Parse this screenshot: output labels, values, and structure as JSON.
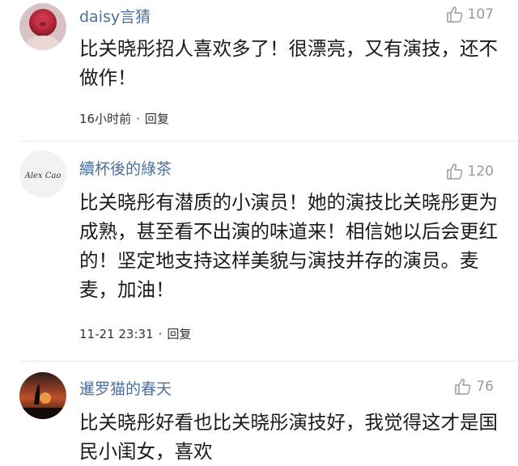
{
  "comments": [
    {
      "username": "daisy言猜",
      "likes": "107",
      "text": "比关晓彤招人喜欢多了！很漂亮，又有演技，还不做作！",
      "time": "16小时前",
      "reply": "回复",
      "avatar": "rose"
    },
    {
      "username": "續杯後的綠茶",
      "likes": "120",
      "text": "比关晓彤有潜质的小演员！她的演技比关晓彤更为成熟，甚至看不出演的味道来！相信她以后会更红的！坚定地支持这样美貌与演技并存的演员。麦麦，加油！",
      "time": "11-21 23:31",
      "reply": "回复",
      "avatar": "signature",
      "avatar_text": "Alex Cao"
    },
    {
      "username": "暹罗猫的春天",
      "likes": "76",
      "text": "比关晓彤好看也比关晓彤演技好，我觉得这才是国民小闺女，喜欢",
      "avatar": "sunset"
    }
  ],
  "meta_separator": "·",
  "colors": {
    "username": "#4a6f9e",
    "muted": "#9a9a9a",
    "text": "#1a1a1a"
  }
}
